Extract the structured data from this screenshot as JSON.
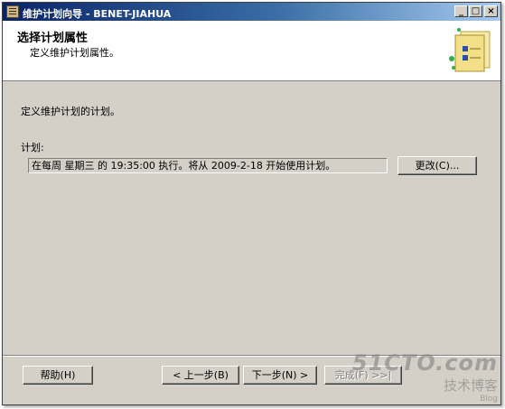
{
  "window": {
    "title": "维护计划向导 - BENET-JIAHUA",
    "controls": {
      "minimize": "_",
      "maximize": "□",
      "close": "×"
    }
  },
  "header": {
    "title": "选择计划属性",
    "subtitle": "定义维护计划属性。",
    "graphic_icon": "wizard-graphic-icon"
  },
  "main": {
    "instruction": "定义维护计划的计划。",
    "schedule_label": "计划:",
    "schedule_value": "在每周 星期三 的 19:35:00 执行。将从 2009-2-18 开始使用计划。",
    "change_button": "更改(C)..."
  },
  "footer": {
    "help": "帮助(H)",
    "back": "< 上一步(B)",
    "next": "下一步(N) >",
    "finish": "完成(F) >>|"
  },
  "watermark": {
    "line1": "51CTO.com",
    "line2": "技术博客",
    "line3": "Blog"
  }
}
